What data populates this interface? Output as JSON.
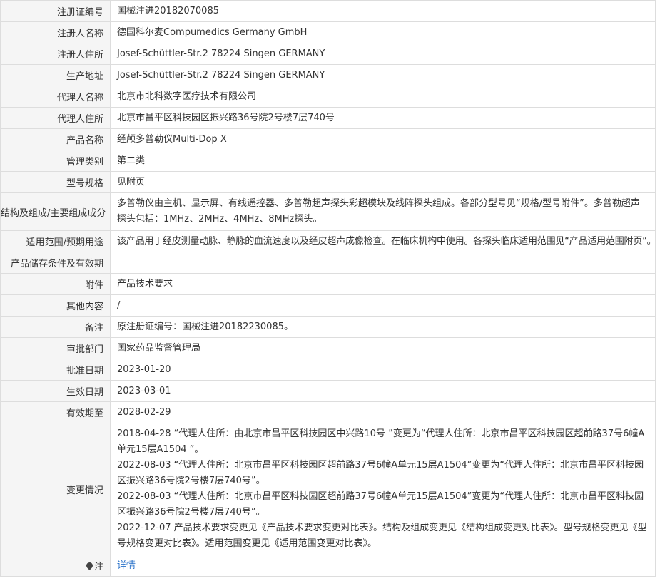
{
  "rows": [
    {
      "label": "注册证编号",
      "value": "国械注进20182070085"
    },
    {
      "label": "注册人名称",
      "value": "德国科尔麦Compumedics Germany GmbH"
    },
    {
      "label": "注册人住所",
      "value": "Josef-Schüttler-Str.2 78224 Singen GERMANY"
    },
    {
      "label": "生产地址",
      "value": "Josef-Schüttler-Str.2 78224 Singen GERMANY"
    },
    {
      "label": "代理人名称",
      "value": "北京市北科数字医疗技术有限公司"
    },
    {
      "label": "代理人住所",
      "value": "北京市昌平区科技园区振兴路36号院2号楼7层740号"
    },
    {
      "label": "产品名称",
      "value": "经颅多普勒仪Multi-Dop X"
    },
    {
      "label": "管理类别",
      "value": "第二类"
    },
    {
      "label": "型号规格",
      "value": "见附页"
    },
    {
      "label": "结构及组成/主要组成成分",
      "value": "多普勒仪由主机、显示屏、有线遥控器、多普勒超声探头彩超模块及线阵探头组成。各部分型号见“规格/型号附件”。多普勒超声探头包括：1MHz、2MHz、4MHz、8MHz探头。"
    },
    {
      "label": "适用范围/预期用途",
      "value": "该产品用于经皮测量动脉、静脉的血流速度以及经皮超声成像检查。在临床机构中使用。各探头临床适用范围见“产品适用范围附页”。"
    },
    {
      "label": "产品储存条件及有效期",
      "value": ""
    },
    {
      "label": "附件",
      "value": "产品技术要求"
    },
    {
      "label": "其他内容",
      "value": "/"
    },
    {
      "label": "备注",
      "value": "原注册证编号：国械注进20182230085。"
    },
    {
      "label": "审批部门",
      "value": "国家药品监督管理局"
    },
    {
      "label": "批准日期",
      "value": "2023-01-20"
    },
    {
      "label": "生效日期",
      "value": "2023-03-01"
    },
    {
      "label": "有效期至",
      "value": "2028-02-29"
    }
  ],
  "changes": {
    "label": "变更情况",
    "entries": [
      "2018-04-28 “代理人住所：由北京市昌平区科技园区中兴路10号 ”变更为“代理人住所：北京市昌平区科技园区超前路37号6幢A单元15层A1504 ”。",
      "2022-08-03 “代理人住所：北京市昌平区科技园区超前路37号6幢A单元15层A1504”变更为“代理人住所：北京市昌平区科技园区振兴路36号院2号楼7层740号”。",
      "2022-08-03 “代理人住所：北京市昌平区科技园区超前路37号6幢A单元15层A1504”变更为“代理人住所：北京市昌平区科技园区振兴路36号院2号楼7层740号”。",
      "2022-12-07 产品技术要求变更见《产品技术要求变更对比表》。结构及组成变更见《结构组成变更对比表》。型号规格变更见《型号规格变更对比表》。适用范围变更见《适用范围变更对比表》。"
    ]
  },
  "note": {
    "label": "注",
    "icon": "map-pin-icon",
    "link_text": "详情",
    "link_color": "#2a72c9"
  }
}
